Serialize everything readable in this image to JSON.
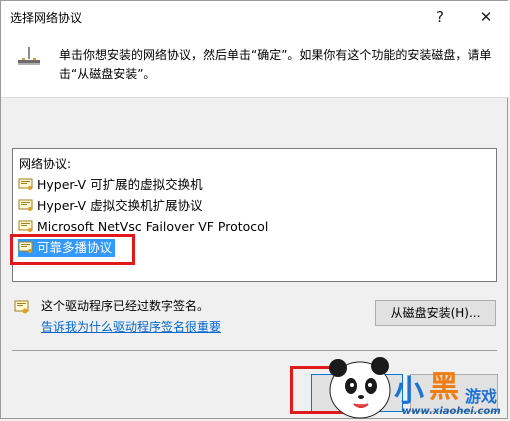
{
  "window": {
    "title": "选择网络协议",
    "help_label": "?",
    "close_label": "✕"
  },
  "header": {
    "icon": "network-protocol-icon",
    "instruction": "单击你想安装的网络协议，然后单击“确定”。如果你有这个功能的安装磁盘，请单击“从磁盘安装”。"
  },
  "protocol_list": {
    "label": "网络协议:",
    "items": [
      {
        "label": "Hyper-V 可扩展的虚拟交换机",
        "selected": false
      },
      {
        "label": "Hyper-V 虚拟交换机扩展协议",
        "selected": false
      },
      {
        "label": "Microsoft NetVsc Failover VF Protocol",
        "selected": false
      },
      {
        "label": "可靠多播协议",
        "selected": true
      }
    ]
  },
  "signature": {
    "icon": "certificate-icon",
    "text": "这个驱动程序已经过数字签名。",
    "link": "告诉我为什么驱动程序签名很重要"
  },
  "buttons": {
    "have_disk": "从磁盘安装(H)..."
  },
  "watermark": {
    "brand_1": "小",
    "brand_2": "黑",
    "brand_3": "游戏",
    "url": "www.xiaohei.com"
  },
  "colors": {
    "selection": "#3399ff",
    "highlight_box": "#e2191b",
    "link": "#0066cc"
  }
}
